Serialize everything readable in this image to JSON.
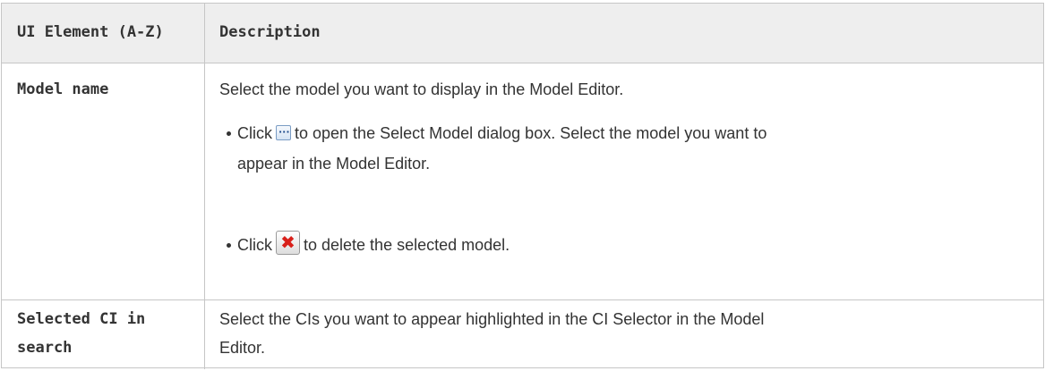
{
  "table": {
    "header": {
      "col_element": "UI Element (A-Z)",
      "col_description": "Description"
    },
    "rows": [
      {
        "element": "Model name",
        "description": "Select the model you want to display in the Model Editor.",
        "bullets": [
          {
            "prefix": "Click",
            "icon": "ellipsis-browse-icon",
            "line1": "to open the Select Model dialog box. Select the model you want to",
            "line2": "appear in the Model Editor."
          },
          {
            "prefix": "Click",
            "icon": "red-x-delete-icon",
            "line1": "to delete the selected model."
          }
        ]
      },
      {
        "element_line1": "Selected CI in",
        "element_line2": "search",
        "description_line1": "Select the CIs you want to appear highlighted in the CI Selector in the Model",
        "description_line2": "Editor."
      }
    ]
  },
  "colors": {
    "header_bg": "#eeeeee",
    "border": "#c6c6c6",
    "text": "#333333",
    "delete_icon": "#d8201a"
  }
}
